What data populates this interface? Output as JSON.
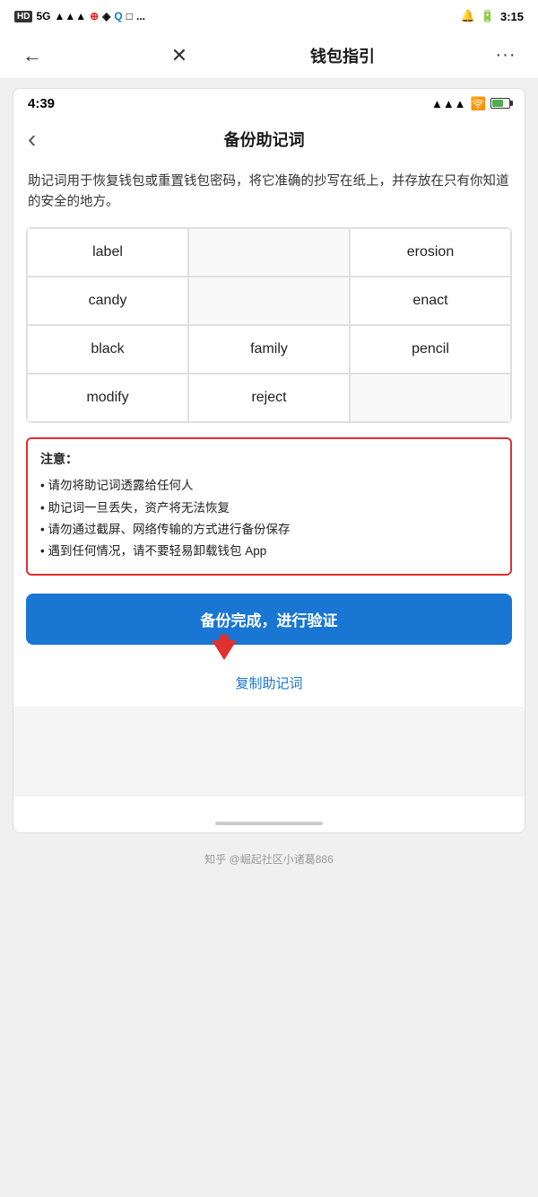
{
  "outer_status": {
    "left_text": "HD 5G",
    "time": "3:15"
  },
  "top_nav": {
    "back_icon": "←",
    "close_icon": "✕",
    "title": "钱包指引",
    "more_icon": "···"
  },
  "inner_status": {
    "time": "4:39"
  },
  "inner_nav": {
    "back_icon": "‹",
    "title": "备份助记词"
  },
  "description": "助记词用于恢复钱包或重置钱包密码，将它准确的抄写在纸上，并存放在只有你知道的安全的地方。",
  "mnemonic_words": [
    {
      "word": "label",
      "col": 0
    },
    {
      "word": "",
      "col": 1
    },
    {
      "word": "erosion",
      "col": 2
    },
    {
      "word": "candy",
      "col": 0
    },
    {
      "word": "",
      "col": 1
    },
    {
      "word": "enact",
      "col": 2
    },
    {
      "word": "black",
      "col": 0
    },
    {
      "word": "family",
      "col": 1
    },
    {
      "word": "pencil",
      "col": 2
    },
    {
      "word": "modify",
      "col": 0
    },
    {
      "word": "reject",
      "col": 1
    },
    {
      "word": "",
      "col": 2
    }
  ],
  "warning": {
    "title": "注意：",
    "items": [
      "• 请勿将助记词透露给任何人",
      "• 助记词一旦丢失，资产将无法恢复",
      "• 请勿通过截屏、网络传输的方式进行备份保存",
      "• 遇到任何情况，请不要轻易卸载钱包 App"
    ]
  },
  "button": {
    "primary_label": "备份完成，进行验证",
    "copy_label": "复制助记词"
  },
  "footer": {
    "credit": "知乎 @崛起社区小诸葛886"
  }
}
